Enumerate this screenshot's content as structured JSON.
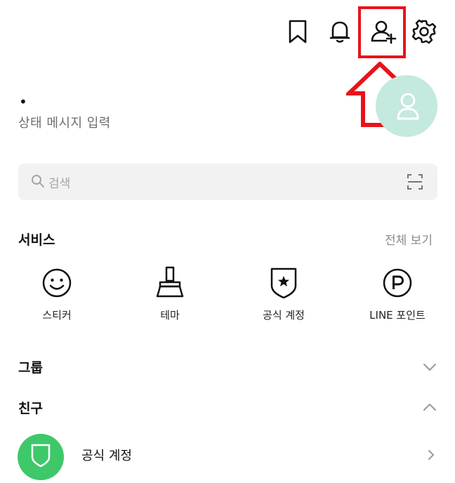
{
  "topbar": {
    "icons": [
      "bookmark-icon",
      "bell-icon",
      "add-friend-icon",
      "settings-icon"
    ],
    "highlight_color": "#e8131b"
  },
  "profile": {
    "name": "•",
    "status_message": "상태 메시지 입력",
    "avatar_color": "#c4e9df"
  },
  "search": {
    "placeholder": "검색"
  },
  "services": {
    "title": "서비스",
    "see_all": "전체 보기",
    "items": [
      {
        "label": "스티커",
        "icon": "smiley-icon"
      },
      {
        "label": "테마",
        "icon": "brush-icon"
      },
      {
        "label": "공식 계정",
        "icon": "shield-star-icon"
      },
      {
        "label": "LINE 포인트",
        "icon": "points-icon"
      }
    ]
  },
  "groups": {
    "title": "그룹"
  },
  "friends": {
    "title": "친구",
    "items": [
      {
        "name": "공식 계정",
        "avatar_color": "#3ec86a"
      }
    ]
  }
}
